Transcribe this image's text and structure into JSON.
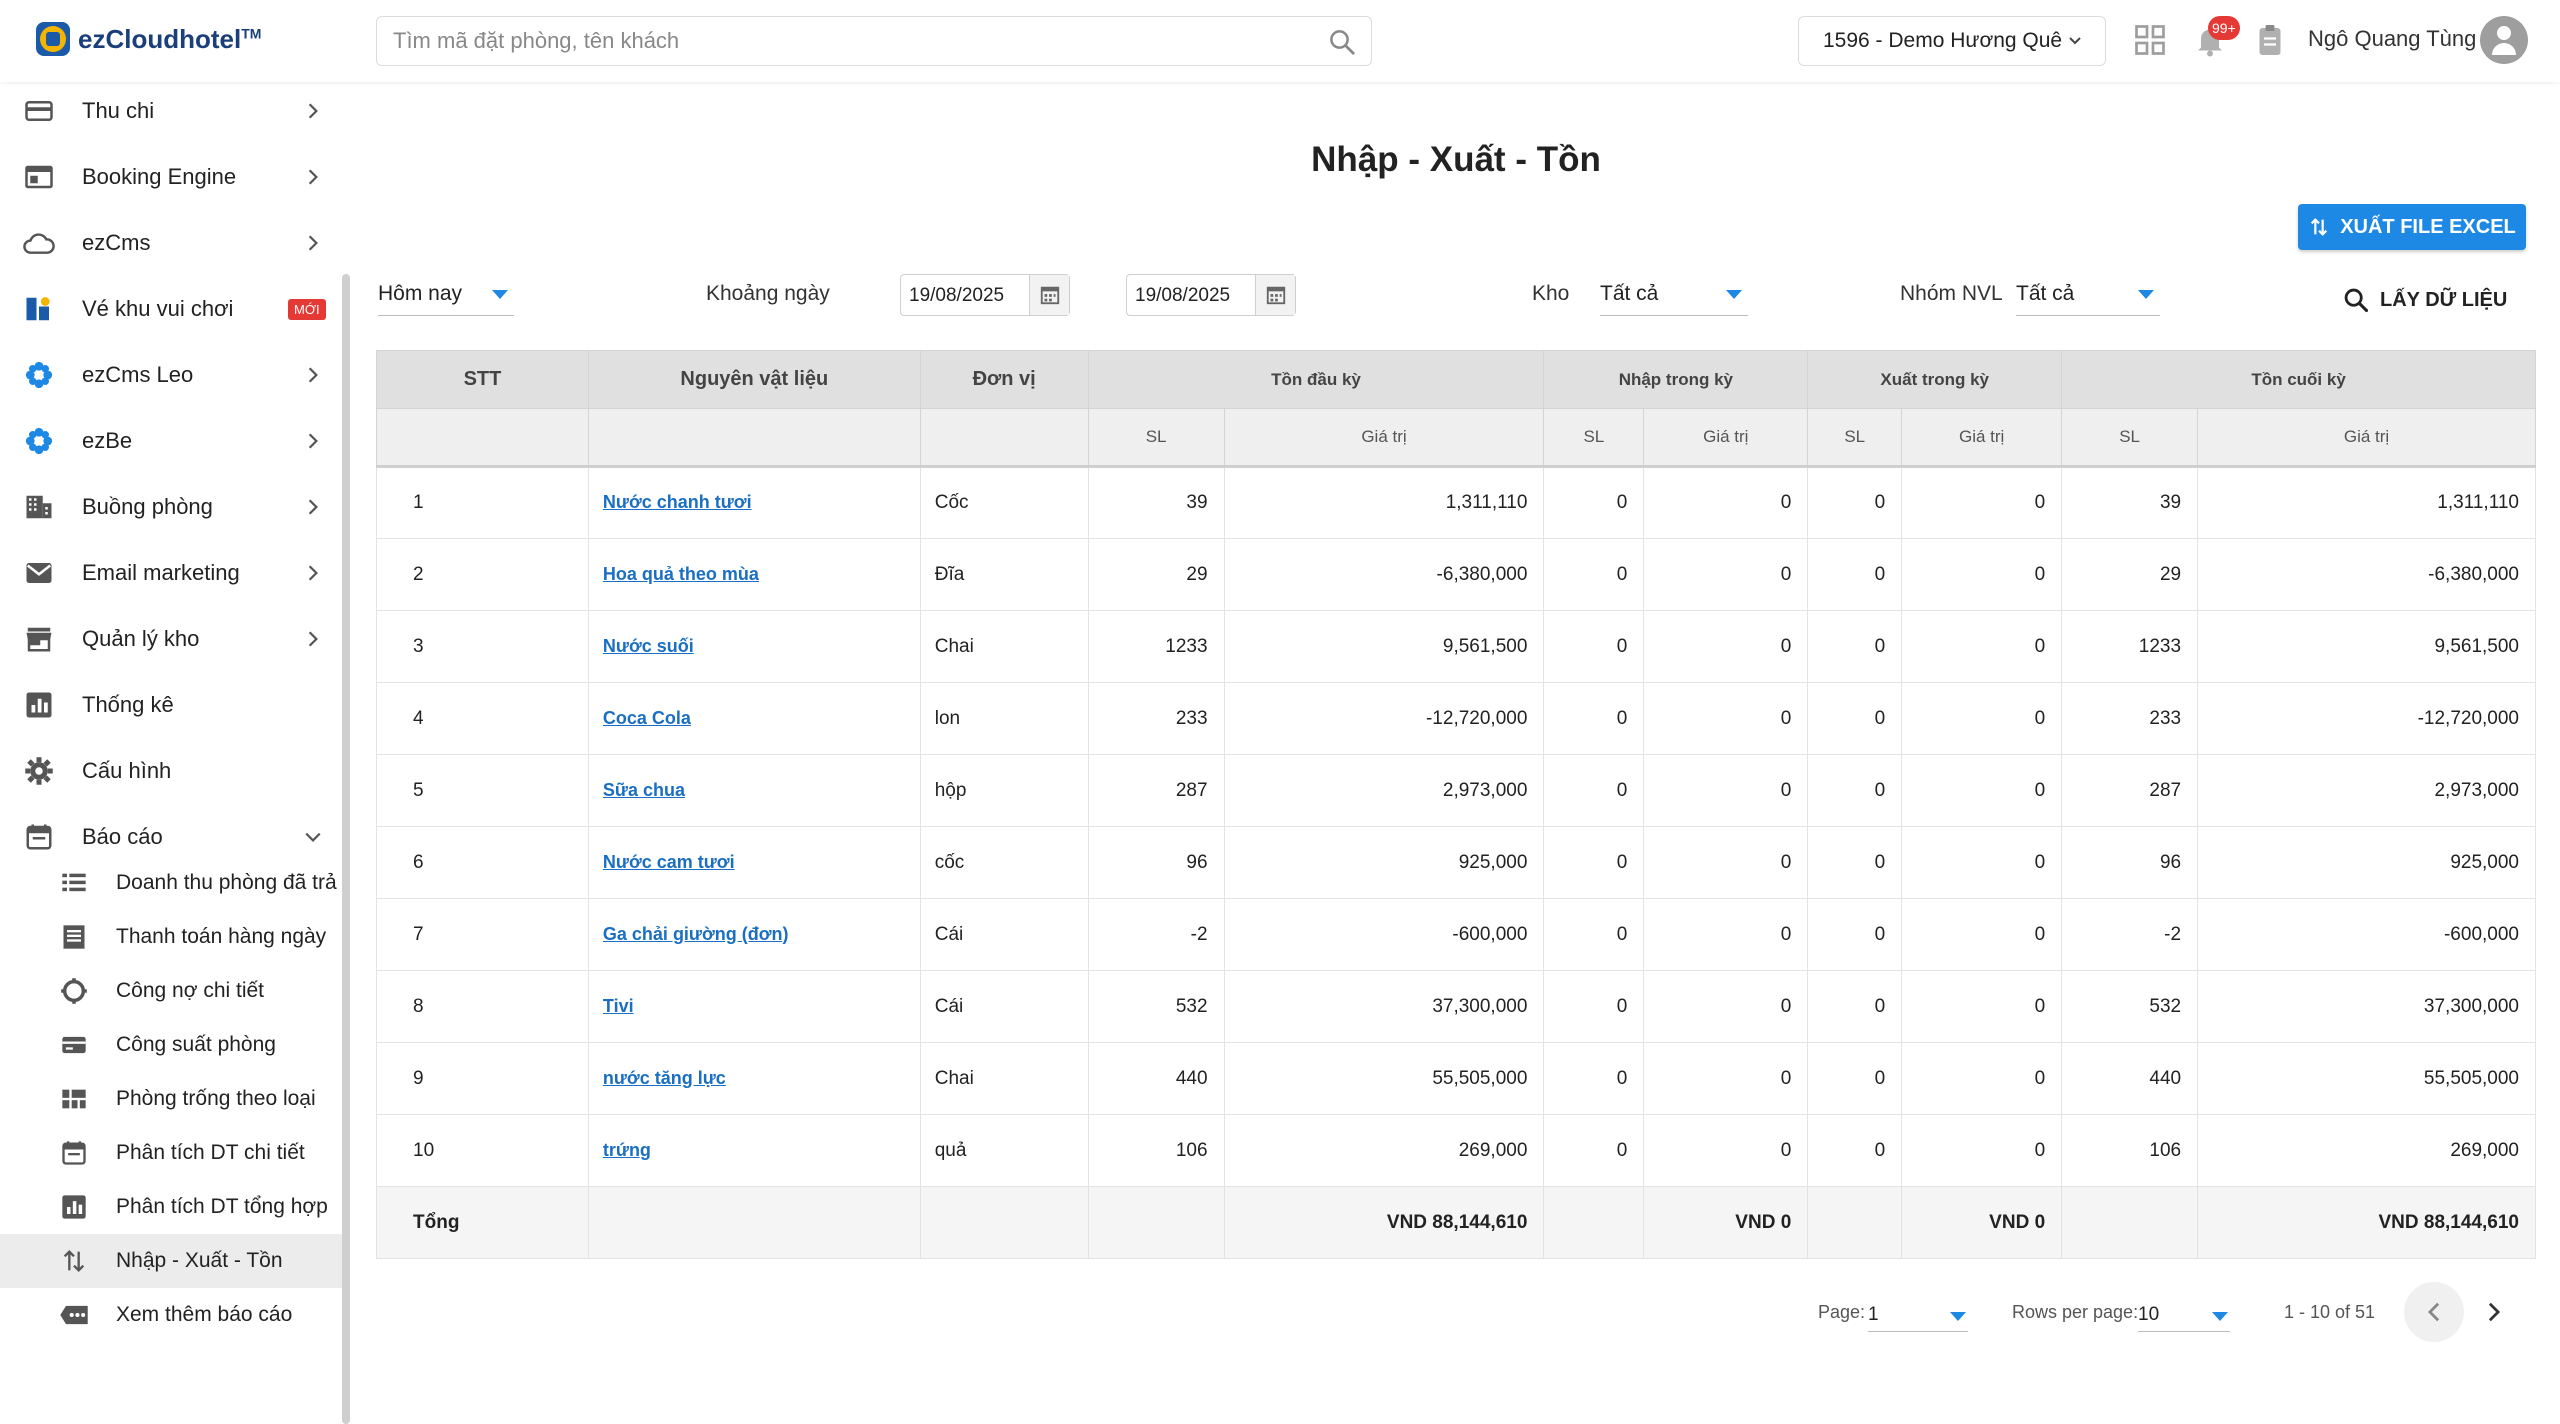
{
  "app": {
    "brand": "ezCloudhotel",
    "tm": "TM"
  },
  "header": {
    "search_placeholder": "Tìm mã đặt phòng, tên khách",
    "hotel": "1596 - Demo Hương Quê",
    "notification_count": "99+",
    "user_name": "Ngô Quang Tùng"
  },
  "sidebar": {
    "items": [
      {
        "label": "Thu chi",
        "icon": "card-icon"
      },
      {
        "label": "Booking Engine",
        "icon": "web-icon"
      },
      {
        "label": "ezCms",
        "icon": "cloud-icon"
      },
      {
        "label": "Vé khu vui chơi",
        "icon": "ticket-icon",
        "badge": "MỚI"
      },
      {
        "label": "ezCms Leo",
        "icon": "flower-icon"
      },
      {
        "label": "ezBe",
        "icon": "flower-icon"
      },
      {
        "label": "Buồng phòng",
        "icon": "building-icon"
      },
      {
        "label": "Email marketing",
        "icon": "mail-icon"
      },
      {
        "label": "Quản lý kho",
        "icon": "store-icon"
      },
      {
        "label": "Thống kê",
        "icon": "chart-icon"
      },
      {
        "label": "Cấu hình",
        "icon": "gear-icon"
      },
      {
        "label": "Báo cáo",
        "icon": "calendar-icon"
      }
    ],
    "report_items": [
      {
        "label": "Doanh thu phòng đã trả",
        "icon": "list-icon"
      },
      {
        "label": "Thanh toán hàng ngày",
        "icon": "document-icon"
      },
      {
        "label": "Công nợ chi tiết",
        "icon": "gear-icon"
      },
      {
        "label": "Công suất phòng",
        "icon": "card-icon"
      },
      {
        "label": "Phòng trống theo loại",
        "icon": "grid-icon"
      },
      {
        "label": "Phân tích DT chi tiết",
        "icon": "calendar-icon"
      },
      {
        "label": "Phân tích DT tổng hợp",
        "icon": "chart-icon"
      },
      {
        "label": "Nhập - Xuất - Tồn",
        "icon": "swap-icon"
      },
      {
        "label": "Xem thêm báo cáo",
        "icon": "more-icon"
      }
    ]
  },
  "main": {
    "title": "Nhập - Xuất - Tồn",
    "export_label": "XUẤT FILE EXCEL",
    "fetch_label": "LẤY DỮ LIỆU",
    "filters": {
      "period": "Hôm nay",
      "range_label": "Khoảng ngày",
      "from_date": "19/08/2025",
      "to_date": "19/08/2025",
      "warehouse_label": "Kho",
      "warehouse": "Tất cả",
      "group_label": "Nhóm NVL",
      "group": "Tất cả"
    },
    "table": {
      "headers": {
        "stt": "STT",
        "material": "Nguyên vật liệu",
        "unit": "Đơn vị",
        "opening": "Tồn đầu kỳ",
        "import": "Nhập trong kỳ",
        "export": "Xuất trong kỳ",
        "closing": "Tồn cuối kỳ",
        "qty": "SL",
        "value": "Giá trị"
      },
      "rows": [
        {
          "stt": "1",
          "name": "Nước chanh tươi",
          "unit": "Cốc",
          "open_qty": "39",
          "open_val": "1,311,110",
          "in_qty": "0",
          "in_val": "0",
          "out_qty": "0",
          "out_val": "0",
          "close_qty": "39",
          "close_val": "1,311,110"
        },
        {
          "stt": "2",
          "name": "Hoa quả theo mùa",
          "unit": "Đĩa",
          "open_qty": "29",
          "open_val": "-6,380,000",
          "in_qty": "0",
          "in_val": "0",
          "out_qty": "0",
          "out_val": "0",
          "close_qty": "29",
          "close_val": "-6,380,000"
        },
        {
          "stt": "3",
          "name": "Nước suối",
          "unit": "Chai",
          "open_qty": "1233",
          "open_val": "9,561,500",
          "in_qty": "0",
          "in_val": "0",
          "out_qty": "0",
          "out_val": "0",
          "close_qty": "1233",
          "close_val": "9,561,500"
        },
        {
          "stt": "4",
          "name": "Coca Cola",
          "unit": "lon",
          "open_qty": "233",
          "open_val": "-12,720,000",
          "in_qty": "0",
          "in_val": "0",
          "out_qty": "0",
          "out_val": "0",
          "close_qty": "233",
          "close_val": "-12,720,000"
        },
        {
          "stt": "5",
          "name": "Sữa chua",
          "unit": "hộp",
          "open_qty": "287",
          "open_val": "2,973,000",
          "in_qty": "0",
          "in_val": "0",
          "out_qty": "0",
          "out_val": "0",
          "close_qty": "287",
          "close_val": "2,973,000"
        },
        {
          "stt": "6",
          "name": "Nước cam tươi",
          "unit": "cốc",
          "open_qty": "96",
          "open_val": "925,000",
          "in_qty": "0",
          "in_val": "0",
          "out_qty": "0",
          "out_val": "0",
          "close_qty": "96",
          "close_val": "925,000"
        },
        {
          "stt": "7",
          "name": "Ga chải giường (đơn)",
          "unit": "Cái",
          "open_qty": "-2",
          "open_val": "-600,000",
          "in_qty": "0",
          "in_val": "0",
          "out_qty": "0",
          "out_val": "0",
          "close_qty": "-2",
          "close_val": "-600,000"
        },
        {
          "stt": "8",
          "name": "Tivi",
          "unit": "Cái",
          "open_qty": "532",
          "open_val": "37,300,000",
          "in_qty": "0",
          "in_val": "0",
          "out_qty": "0",
          "out_val": "0",
          "close_qty": "532",
          "close_val": "37,300,000"
        },
        {
          "stt": "9",
          "name": "nước tăng lực",
          "unit": "Chai",
          "open_qty": "440",
          "open_val": "55,505,000",
          "in_qty": "0",
          "in_val": "0",
          "out_qty": "0",
          "out_val": "0",
          "close_qty": "440",
          "close_val": "55,505,000"
        },
        {
          "stt": "10",
          "name": "trứng",
          "unit": "quả",
          "open_qty": "106",
          "open_val": "269,000",
          "in_qty": "0",
          "in_val": "0",
          "out_qty": "0",
          "out_val": "0",
          "close_qty": "106",
          "close_val": "269,000"
        }
      ],
      "total": {
        "label": "Tổng",
        "open_val": "VND 88,144,610",
        "in_val": "VND 0",
        "out_val": "VND 0",
        "close_val": "VND 88,144,610"
      }
    },
    "pagination": {
      "page_label": "Page:",
      "page": "1",
      "rows_label": "Rows per page:",
      "rows": "10",
      "range": "1 - 10 of 51"
    }
  },
  "colors": {
    "accent": "#1e88e5",
    "link": "#1a6fc2",
    "badge": "#e53935"
  }
}
